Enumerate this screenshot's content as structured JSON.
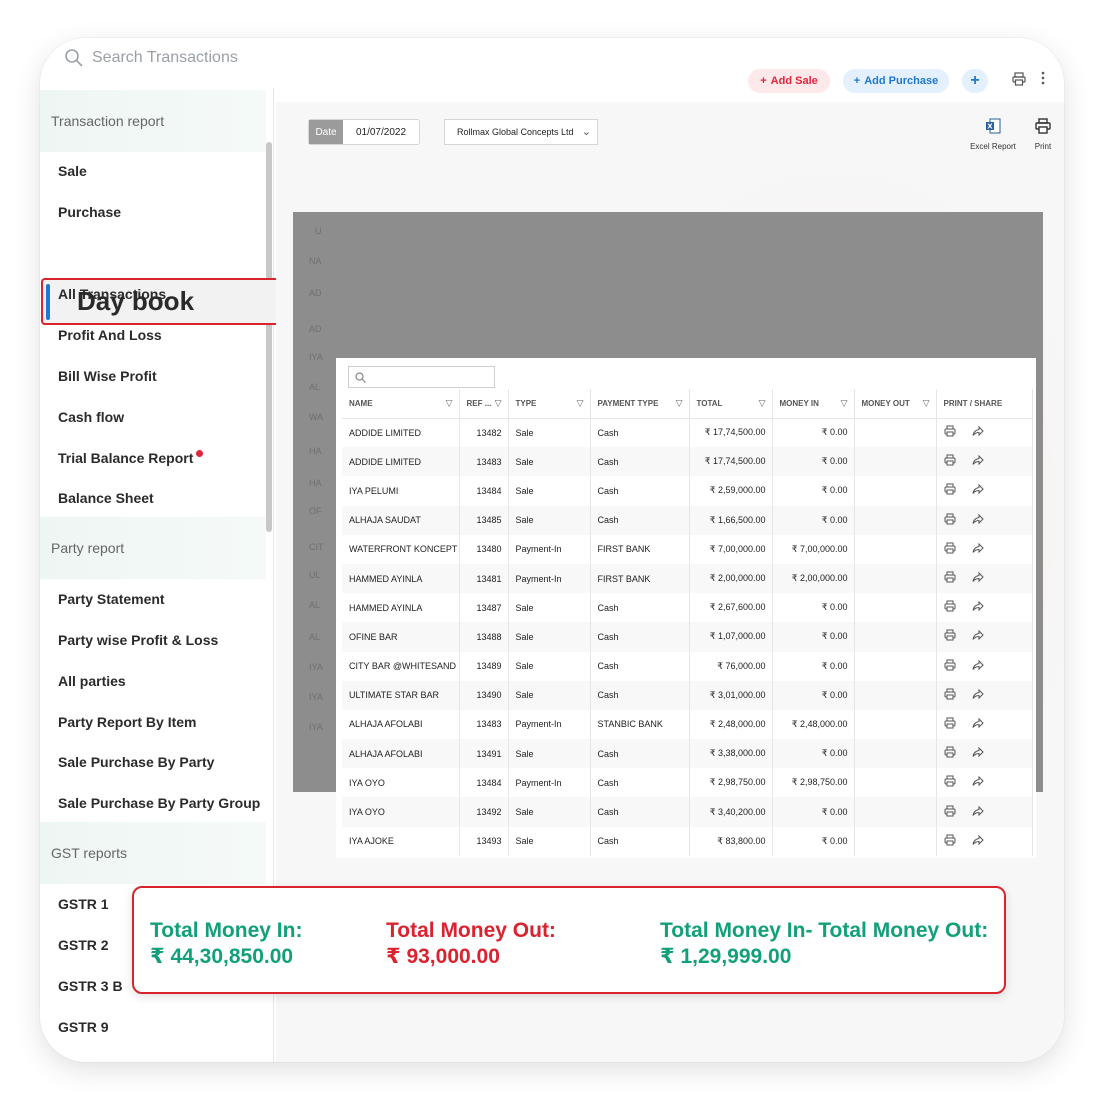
{
  "search": {
    "placeholder": "Search Transactions"
  },
  "toolbar": {
    "add_sale": "Add Sale",
    "add_purchase": "Add Purchase",
    "add_more": "+"
  },
  "sidebar": {
    "sections": [
      {
        "title": "Transaction report"
      },
      {
        "title": "Party report"
      },
      {
        "title": "GST reports"
      }
    ],
    "items": [
      "Sale",
      "Purchase",
      "Day book",
      "All Transactions",
      "Profit And Loss",
      "Bill Wise Profit",
      "Cash flow",
      "Trial Balance Report",
      "Balance Sheet",
      "Party Statement",
      "Party wise Profit & Loss",
      "All parties",
      "Party Report By Item",
      "Sale Purchase By Party",
      "Sale Purchase By Party Group",
      "GSTR 1",
      "GSTR 2",
      "GSTR 3 B",
      "GSTR 9"
    ]
  },
  "filters": {
    "date_label": "Date",
    "date_value": "01/07/2022",
    "firm": "Rollmax Global Concepts Ltd"
  },
  "actions": {
    "excel": "Excel Report",
    "print": "Print"
  },
  "table": {
    "headers": [
      "NAME",
      "REF ...",
      "TYPE",
      "PAYMENT TYPE",
      "TOTAL",
      "MONEY IN",
      "MONEY OUT",
      "PRINT / SHARE"
    ],
    "rows": [
      [
        "ADDIDE LIMITED",
        "13482",
        "Sale",
        "Cash",
        "₹ 17,74,500.00",
        "₹ 0.00"
      ],
      [
        "ADDIDE LIMITED",
        "13483",
        "Sale",
        "Cash",
        "₹ 17,74,500.00",
        "₹ 0.00"
      ],
      [
        "IYA PELUMI",
        "13484",
        "Sale",
        "Cash",
        "₹ 2,59,000.00",
        "₹ 0.00"
      ],
      [
        "ALHAJA SAUDAT",
        "13485",
        "Sale",
        "Cash",
        "₹ 1,66,500.00",
        "₹ 0.00"
      ],
      [
        "WATERFRONT KONCEPT",
        "13480",
        "Payment-In",
        "FIRST BANK",
        "₹ 7,00,000.00",
        "₹ 7,00,000.00"
      ],
      [
        "HAMMED AYINLA",
        "13481",
        "Payment-In",
        "FIRST BANK",
        "₹ 2,00,000.00",
        "₹ 2,00,000.00"
      ],
      [
        "HAMMED AYINLA",
        "13487",
        "Sale",
        "Cash",
        "₹ 2,67,600.00",
        "₹ 0.00"
      ],
      [
        "OFINE BAR",
        "13488",
        "Sale",
        "Cash",
        "₹ 1,07,000.00",
        "₹ 0.00"
      ],
      [
        "CITY BAR @WHITESAND",
        "13489",
        "Sale",
        "Cash",
        "₹ 76,000.00",
        "₹ 0.00"
      ],
      [
        "ULTIMATE STAR BAR",
        "13490",
        "Sale",
        "Cash",
        "₹ 3,01,000.00",
        "₹ 0.00"
      ],
      [
        "ALHAJA AFOLABI",
        "13483",
        "Payment-In",
        "STANBIC BANK",
        "₹ 2,48,000.00",
        "₹ 2,48,000.00"
      ],
      [
        "ALHAJA AFOLABI",
        "13491",
        "Sale",
        "Cash",
        "₹ 3,38,000.00",
        "₹ 0.00"
      ],
      [
        "IYA OYO",
        "13484",
        "Payment-In",
        "Cash",
        "₹ 2,98,750.00",
        "₹ 2,98,750.00"
      ],
      [
        "IYA OYO",
        "13492",
        "Sale",
        "Cash",
        "₹ 3,40,200.00",
        "₹ 0.00"
      ],
      [
        "IYA AJOKE",
        "13493",
        "Sale",
        "Cash",
        "₹ 83,800.00",
        "₹ 0.00"
      ]
    ]
  },
  "ghost": {
    "top": "U",
    "labels": [
      "NA",
      "AD",
      "AD",
      "IYA",
      "AL",
      "WA",
      "HA",
      "HA",
      "OF",
      "CIT",
      "UL",
      "AL",
      "AL",
      "IYA",
      "IYA",
      "IYA"
    ]
  },
  "totals": {
    "money_in_label": "Total Money In:",
    "money_in_value": "₹ 44,30,850.00",
    "money_out_label": "Total Money Out:",
    "money_out_value": "₹ 93,000.00",
    "net_label": "Total Money In- Total Money Out:",
    "net_value": "₹ 1,29,999.00"
  },
  "colors": {
    "accent_red": "#d9232e",
    "accent_blue": "#1f78d1",
    "accent_green": "#12a07a"
  }
}
